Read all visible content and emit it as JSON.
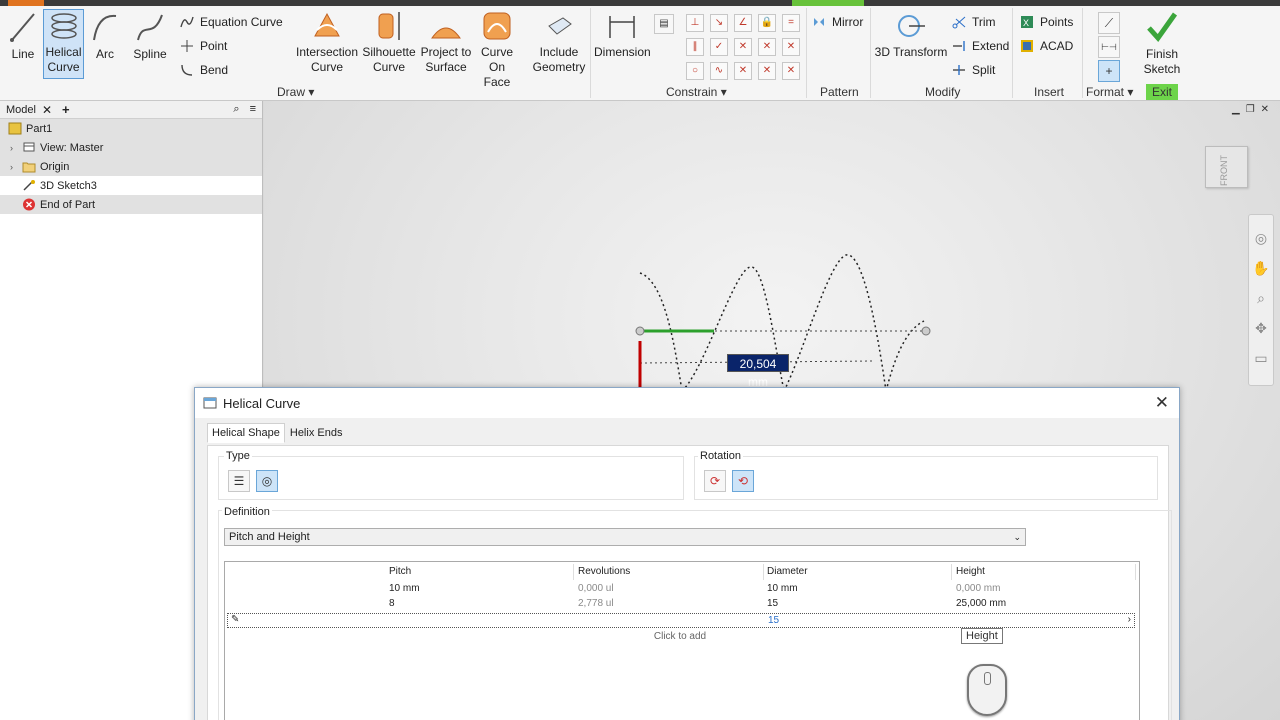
{
  "ribbon": {
    "draw": {
      "line": "Line",
      "helical_curve": "Helical\nCurve",
      "arc": "Arc",
      "spline": "Spline",
      "equation_curve": "Equation Curve",
      "point": "Point",
      "bend": "Bend",
      "intersection_curve": "Intersection\nCurve",
      "silhouette_curve": "Silhouette\nCurve",
      "project_to_surface": "Project to\nSurface",
      "curve_on_face": "Curve\nOn Face",
      "include_geometry": "Include\nGeometry",
      "group_label": "Draw"
    },
    "constrain": {
      "dimension": "Dimension",
      "group_label": "Constrain"
    },
    "pattern": {
      "mirror": "Mirror",
      "group_label": "Pattern"
    },
    "modify": {
      "transform": "3D Transform",
      "trim": "Trim",
      "extend": "Extend",
      "split": "Split",
      "group_label": "Modify"
    },
    "insert": {
      "points": "Points",
      "acad": "ACAD",
      "group_label": "Insert"
    },
    "format": {
      "group_label": "Format"
    },
    "exit": {
      "finish": "Finish\nSketch",
      "group_label": "Exit"
    }
  },
  "browser": {
    "tab": "Model",
    "items": [
      {
        "label": "Part1",
        "icon": "part-icon"
      },
      {
        "label": "View: Master",
        "icon": "view-icon"
      },
      {
        "label": "Origin",
        "icon": "folder-icon"
      },
      {
        "label": "3D Sketch3",
        "icon": "sketch-icon"
      },
      {
        "label": "End of Part",
        "icon": "end-of-part-icon"
      }
    ]
  },
  "viewport": {
    "viewcube_face": "FRONT",
    "dimension_value": "20,504 mm"
  },
  "dialog": {
    "title": "Helical Curve",
    "tabs": [
      "Helical Shape",
      "Helix Ends"
    ],
    "type_label": "Type",
    "rotation_label": "Rotation",
    "definition_label": "Definition",
    "definition_value": "Pitch and Height",
    "columns": [
      "Pitch",
      "Revolutions",
      "Diameter",
      "Height"
    ],
    "rows": [
      [
        "10 mm",
        "0,000 ul",
        "10 mm",
        "0,000 mm"
      ],
      [
        "8",
        "2,778 ul",
        "15",
        "25,000 mm"
      ]
    ],
    "edit_row_value": "15",
    "click_to_add": "Click to add",
    "tooltip": "Height"
  },
  "colors": {
    "accent_selection": "#cfe3f7",
    "dimension_bg": "#0a246a",
    "exit_green": "#6dd44a",
    "axis_red": "#c00000",
    "axis_green": "#2ca02c"
  }
}
